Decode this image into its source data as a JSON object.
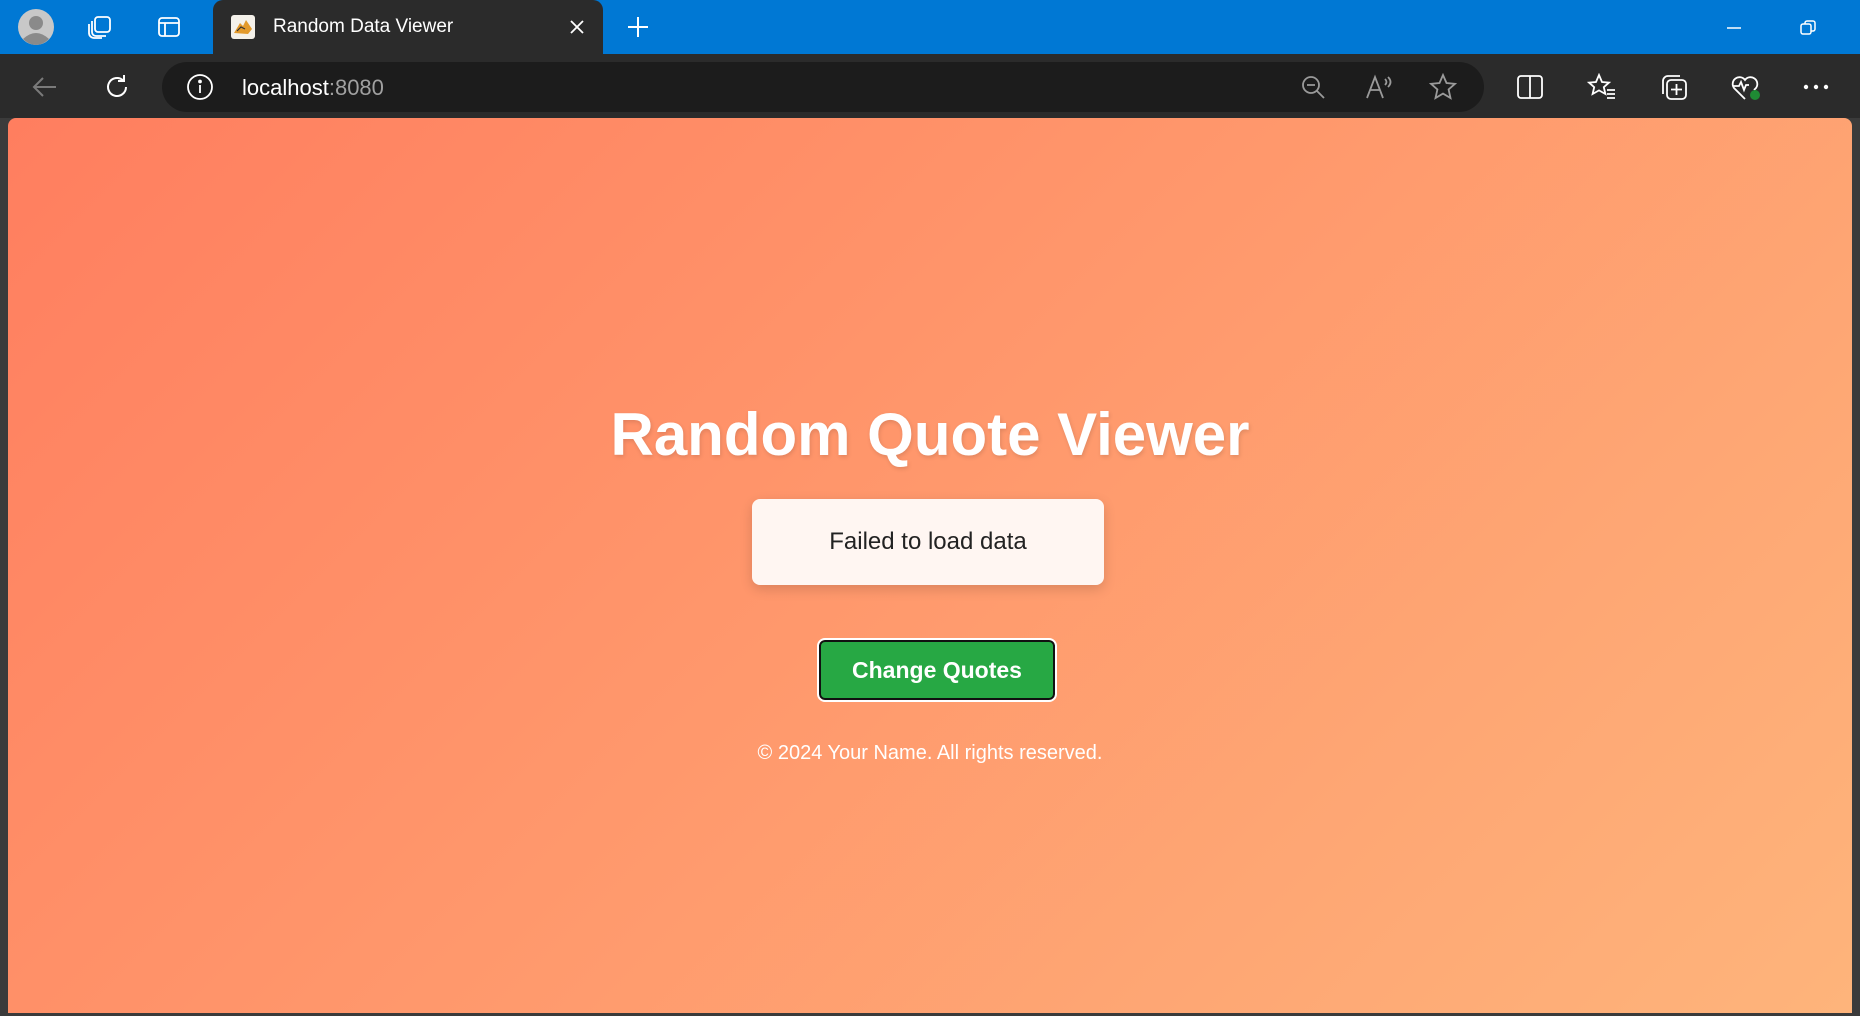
{
  "browser": {
    "tab": {
      "title": "Random Data Viewer"
    },
    "address": {
      "host": "localhost",
      "port": ":8080"
    }
  },
  "icons": {
    "profile": "profile-avatar-icon",
    "workspaces": "workspaces-icon",
    "tab_actions": "tab-actions-icon",
    "close": "close-icon",
    "new_tab": "plus-icon",
    "back": "back-arrow-icon",
    "refresh": "refresh-icon",
    "info": "info-icon",
    "zoom": "zoom-out-icon",
    "read_aloud": "read-aloud-icon",
    "favorite": "star-icon",
    "split": "split-screen-icon",
    "favorites": "favorites-icon",
    "collections": "collections-icon",
    "health": "browser-essentials-icon",
    "more": "more-icon"
  },
  "colors": {
    "titlebar": "#0078d4",
    "gradient_start": "#ff7e5f",
    "gradient_end": "#feb47b",
    "button": "#27a844"
  },
  "page": {
    "title": "Random Quote Viewer",
    "quote_text": "Failed to load data",
    "button_label": "Change Quotes",
    "footer": "© 2024 Your Name. All rights reserved."
  }
}
